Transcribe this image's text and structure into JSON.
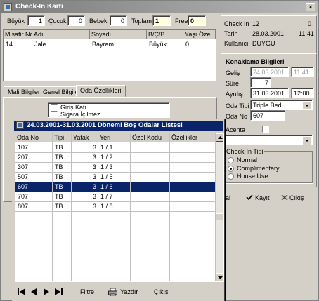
{
  "window": {
    "title": "Check-In Kartı",
    "close_glyph": "×"
  },
  "guest_counts": {
    "adult_label": "Büyük",
    "adult_value": "1",
    "child_label": "Çocuk",
    "child_value": "0",
    "baby_label": "Bebek",
    "baby_value": "0",
    "total_label": "Toplam",
    "total_value": "1",
    "free_label": "Free",
    "free_value": "0"
  },
  "guest_table": {
    "columns": [
      "Misafir No",
      "Adı",
      "Soyadı",
      "B/Ç/B",
      "Yaşı",
      "Özel"
    ],
    "rows": [
      [
        "14",
        "Jale",
        "Bayram",
        "Büyük",
        "0",
        ""
      ]
    ]
  },
  "tabs": [
    "Mali Bilgiler",
    "Genel Bilgiler",
    "Oda Özellikleri"
  ],
  "room_features": [
    "Giriş Katı",
    "Sigara İçilmez"
  ],
  "checkin_info": {
    "checkin_label": "Check In",
    "checkin_value": "12",
    "checkin_extra": "0",
    "date_label": "Tarih",
    "date_value": "28.03.2001",
    "time_value": "11:41",
    "user_label": "Kullanıcı",
    "user_value": "DUYGU"
  },
  "accommodation": {
    "heading": "Konaklama Bilgileri",
    "arrival_label": "Geliş",
    "arrival_date": "24.03.2001",
    "arrival_time": "11:41",
    "duration_label": "Süre",
    "duration_value": "7",
    "departure_label": "Ayrılış",
    "departure_date": "31.03.2001",
    "departure_time": "12:00",
    "room_type_label": "Oda Tipi",
    "room_type_value": "Triple Bed",
    "room_no_label": "Oda No",
    "room_no_value": "607",
    "agency_label": "Acenta"
  },
  "checkin_type": {
    "heading": "Check-In Tipi",
    "options": [
      "Normal",
      "Complimentary",
      "House Use"
    ],
    "selected": "Complimentary"
  },
  "footer_buttons": {
    "partial": "al",
    "save": "Kayıt",
    "exit": "Çıkış"
  },
  "room_dialog": {
    "title": "24.03.2001-31.03.2001 Dönemi Boş Odalar Listesi",
    "columns": [
      "Oda No",
      "Tipi",
      "Yatak",
      "Yeri",
      "Özel Kodu",
      "Özellikler"
    ],
    "rows": [
      [
        "107",
        "TB",
        "3",
        "1 / 1",
        "",
        ""
      ],
      [
        "207",
        "TB",
        "3",
        "1 / 2",
        "",
        ""
      ],
      [
        "307",
        "TB",
        "3",
        "1 / 3",
        "",
        ""
      ],
      [
        "507",
        "TB",
        "3",
        "1 / 5",
        "",
        ""
      ],
      [
        "607",
        "TB",
        "3",
        "1 / 6",
        "",
        ""
      ],
      [
        "707",
        "TB",
        "3",
        "1 / 7",
        "",
        ""
      ],
      [
        "807",
        "TB",
        "3",
        "1 / 8",
        "",
        ""
      ]
    ],
    "selected_room": "607",
    "buttons": {
      "filter": "Filtre",
      "print": "Yazdır",
      "exit": "Çıkış"
    }
  },
  "colors": {
    "selection": "#0a246a",
    "field_yellow": "#ffffe0",
    "face": "#d4d0c8"
  }
}
